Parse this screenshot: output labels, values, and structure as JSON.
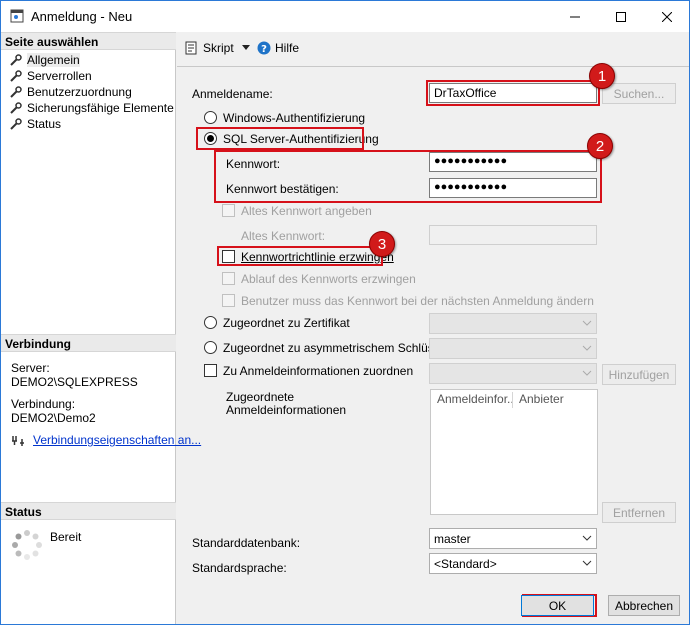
{
  "window": {
    "title": "Anmeldung - Neu"
  },
  "sidebar": {
    "select_page_header": "Seite auswählen",
    "items": [
      {
        "label": "Allgemein"
      },
      {
        "label": "Serverrollen"
      },
      {
        "label": "Benutzerzuordnung"
      },
      {
        "label": "Sicherungsfähige Elemente"
      },
      {
        "label": "Status"
      }
    ],
    "connection_header": "Verbindung",
    "server_label": "Server:",
    "server_value": "DEMO2\\SQLEXPRESS",
    "connection_label": "Verbindung:",
    "connection_value": "DEMO2\\Demo2",
    "connection_link": "Verbindungseigenschaften an...",
    "status_header": "Status",
    "status_value": "Bereit"
  },
  "toolbar": {
    "script_label": "Skript",
    "help_label": "Hilfe"
  },
  "form": {
    "login_name_label": "Anmeldename:",
    "login_name_value": "DrTaxOffice",
    "search_button": "Suchen...",
    "windows_auth_label": "Windows-Authentifizierung",
    "sql_auth_label": "SQL Server-Authentifizierung",
    "password_label": "Kennwort:",
    "password_value": "●●●●●●●●●●●",
    "confirm_password_label": "Kennwort bestätigen:",
    "confirm_password_value": "●●●●●●●●●●●",
    "old_password_check_label": "Altes Kennwort angeben",
    "old_password_label": "Altes Kennwort:",
    "enforce_policy_label": "Kennwortrichtlinie erzwingen",
    "enforce_expiration_label": "Ablauf des Kennworts erzwingen",
    "must_change_label": "Benutzer muss das Kennwort bei der nächsten Anmeldung ändern",
    "certificate_label": "Zugeordnet zu Zertifikat",
    "asym_key_label": "Zugeordnet zu asymmetrischem Schlüssel",
    "credential_map_label": "Zu Anmeldeinformationen zuordnen",
    "add_button": "Hinzufügen",
    "mapped_credentials_label": "Zugeordnete Anmeldeinformationen",
    "list_columns": [
      "Anmeldeinfor...",
      "Anbieter"
    ],
    "remove_button": "Entfernen",
    "default_db_label": "Standarddatenbank:",
    "default_db_value": "master",
    "default_lang_label": "Standardsprache:",
    "default_lang_value": "<Standard>"
  },
  "annotations": {
    "badge1": "1",
    "badge2": "2",
    "badge3": "3",
    "color": "#d6111a"
  },
  "footer": {
    "ok_label": "OK",
    "cancel_label": "Abbrechen"
  }
}
